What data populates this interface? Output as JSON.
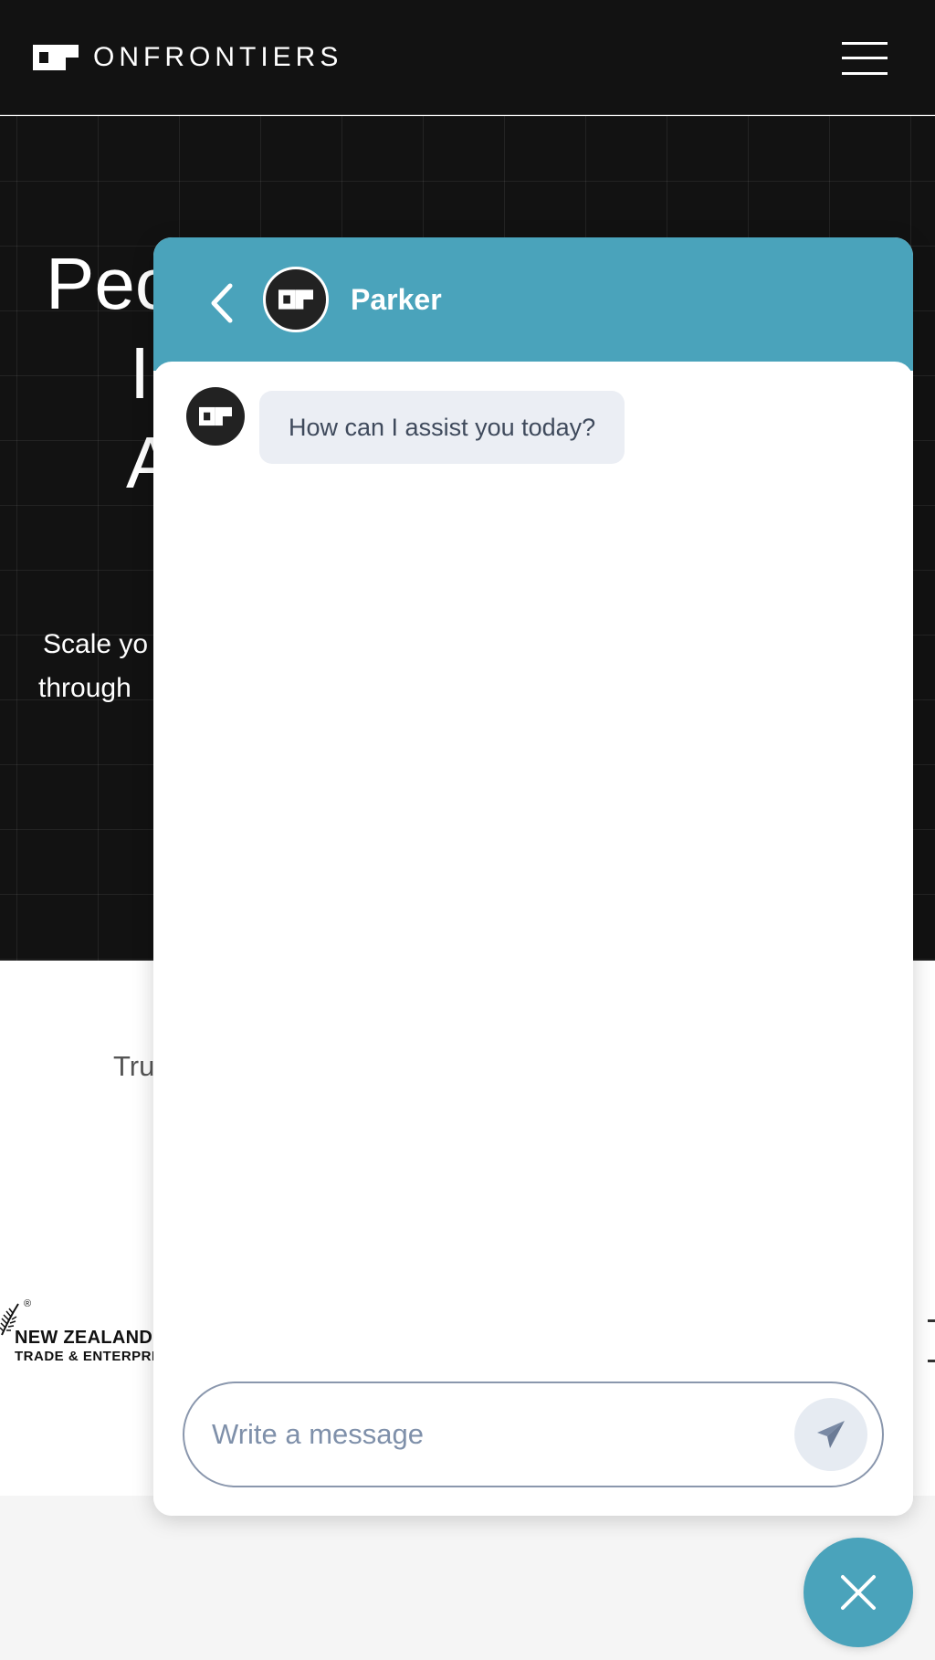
{
  "header": {
    "brand_name": "ONFRONTIERS",
    "logo_icon": "onfrontiers-logo-icon",
    "menu_icon": "hamburger-menu-icon"
  },
  "hero": {
    "title_lines": [
      "Peo",
      "I",
      "A"
    ],
    "subtitle_lines": [
      "Scale yo",
      "through "
    ]
  },
  "trust": {
    "text": "Tru",
    "logos": [
      {
        "line1": "NEW ZEALAND",
        "line2": "TRADE & ENTERPRIS",
        "registered": "®"
      }
    ]
  },
  "chat": {
    "agent_name": "Parker",
    "back_icon": "chevron-left-icon",
    "messages": [
      {
        "from": "agent",
        "text": "How can I assist you today?"
      }
    ],
    "composer": {
      "placeholder": "Write a message",
      "send_icon": "send-icon"
    },
    "close_icon": "close-icon"
  },
  "colors": {
    "header_background": "#121212",
    "chat_accent": "#4aa3bb",
    "bubble_background": "#ebeef4",
    "bubble_text": "#3f4a5c",
    "placeholder": "#7f90aa"
  }
}
